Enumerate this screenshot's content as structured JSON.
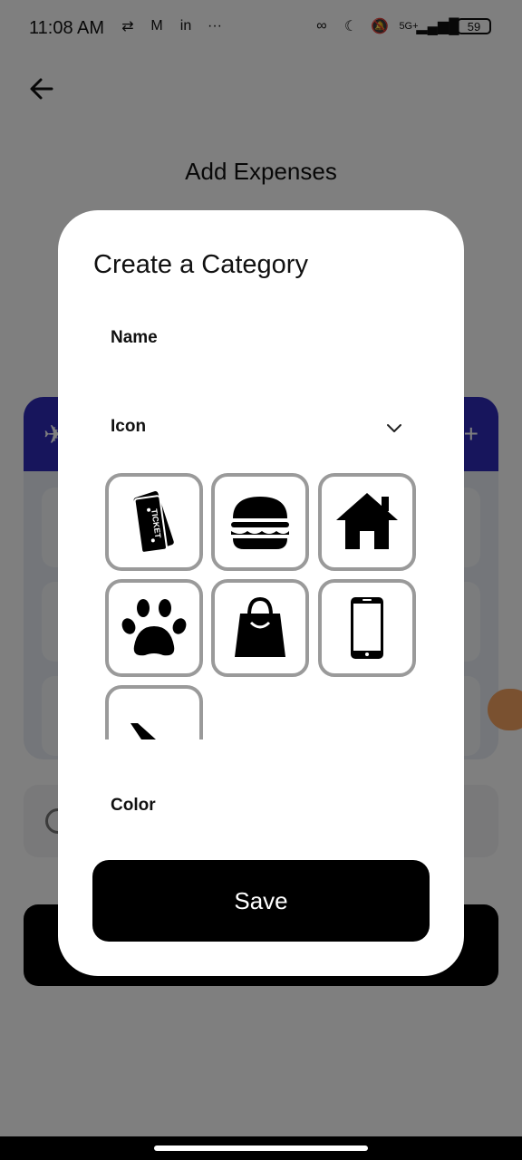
{
  "status_bar": {
    "time": "11:08 AM",
    "battery": "59",
    "network": "5G+"
  },
  "page": {
    "title": "Add Expenses"
  },
  "dialog": {
    "title": "Create a Category",
    "name_label": "Name",
    "icon_label": "Icon",
    "color_label": "Color",
    "save_label": "Save",
    "icons": [
      "ticket-icon",
      "burger-icon",
      "house-icon",
      "paw-icon",
      "shopping-bag-icon",
      "smartphone-icon",
      "airplane-icon"
    ]
  },
  "background": {
    "save_button_color": "#000000",
    "category_header_color": "#2e2ab8"
  }
}
